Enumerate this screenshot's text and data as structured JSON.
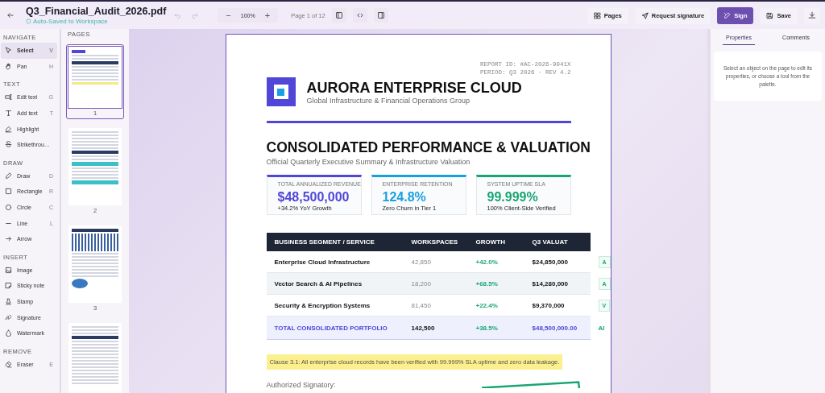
{
  "topbar": {
    "filename": "Q3_Financial_Audit_2026.pdf",
    "autosave": "Auto-Saved to Workspace",
    "undo_disabled": true,
    "redo_disabled": true,
    "zoom": {
      "minus": "−",
      "value": "100%",
      "plus": "+"
    },
    "page_indicator": "Page 1 of 12",
    "actions": [
      {
        "label": "Pages",
        "kind": "secondary"
      },
      {
        "label": "Request signature",
        "kind": "secondary"
      },
      {
        "label": "Sign",
        "kind": "primary"
      },
      {
        "label": "Save",
        "kind": "secondary"
      }
    ]
  },
  "tools": [
    {
      "title": "NAVIGATE",
      "items": [
        {
          "label": "Select",
          "shortcut": "V",
          "selected": true
        },
        {
          "label": "Pan",
          "shortcut": "H",
          "selected": false
        }
      ]
    },
    {
      "title": "TEXT",
      "items": [
        {
          "label": "Edit text",
          "shortcut": "G",
          "selected": false
        },
        {
          "label": "Add text",
          "shortcut": "T",
          "selected": false
        },
        {
          "label": "Highlight",
          "selected": false
        },
        {
          "label": "Strikethrou…",
          "selected": false
        }
      ]
    },
    {
      "title": "DRAW",
      "items": [
        {
          "label": "Draw",
          "shortcut": "D",
          "selected": false
        },
        {
          "label": "Rectangle",
          "shortcut": "R",
          "selected": false
        },
        {
          "label": "Circle",
          "shortcut": "C",
          "selected": false
        },
        {
          "label": "Line",
          "shortcut": "L",
          "selected": false
        },
        {
          "label": "Arrow",
          "selected": false
        }
      ]
    },
    {
      "title": "INSERT",
      "items": [
        {
          "label": "Image",
          "selected": false
        },
        {
          "label": "Sticky note",
          "selected": false
        },
        {
          "label": "Stamp",
          "selected": false
        },
        {
          "label": "Signature",
          "selected": false
        },
        {
          "label": "Watermark",
          "selected": false
        }
      ]
    },
    {
      "title": "REMOVE",
      "items": [
        {
          "label": "Eraser",
          "shortcut": "E",
          "selected": false
        }
      ]
    }
  ],
  "pages": {
    "title": "PAGES",
    "thumbnails": [
      {
        "number": "1",
        "kind": "summary",
        "selected": true
      },
      {
        "number": "2",
        "kind": "invoice",
        "selected": false
      },
      {
        "number": "3",
        "kind": "chart",
        "selected": false
      },
      {
        "kind": "form",
        "selected": false
      }
    ]
  },
  "document": {
    "logo_title": "AURORA ENTERPRISE CLOUD",
    "logo_subtitle": "Global Infrastructure & Financial Operations Group",
    "report_id": "REPORT ID: #AC-2026-9941X",
    "period": "PERIOD: Q3 2026 · REV 4.2",
    "heading": "CONSOLIDATED PERFORMANCE & VALUATION",
    "subheading": "Official Quarterly Executive Summary & Infrastructure Valuation",
    "kpis": [
      {
        "label": "TOTAL ANNUALIZED REVENUE",
        "value": "$48,500,000",
        "note": "+34.2% YoY Growth",
        "color": "#5046d8"
      },
      {
        "label": "ENTERPRISE RETENTION",
        "value": "124.8%",
        "note": "Zero Churn in Tier 1",
        "color": "#1a9fe0"
      },
      {
        "label": "SYSTEM UPTIME SLA",
        "value": "99.999%",
        "note": "100% Client-Side Verified",
        "color": "#17a673"
      }
    ],
    "table": {
      "columns": [
        "BUSINESS SEGMENT / SERVICE",
        "WORKSPACES",
        "GROWTH",
        "Q3 VALUAT"
      ],
      "rows": [
        {
          "kind": "normal",
          "cells": [
            "Enterprise Cloud Infrastructure",
            "42,850",
            "+42.0%",
            "$24,850,000",
            "A"
          ]
        },
        {
          "kind": "normal",
          "cells": [
            "Vector Search & AI Pipelines",
            "18,200",
            "+68.5%",
            "$14,280,000",
            "A"
          ]
        },
        {
          "kind": "normal",
          "cells": [
            "Security & Encryption Systems",
            "81,450",
            "+22.4%",
            "$9,370,000",
            "V"
          ]
        },
        {
          "kind": "total",
          "cells": [
            "TOTAL CONSOLIDATED PORTFOLIO",
            "142,500",
            "+38.5%",
            "$48,500,000.00",
            "AI"
          ]
        }
      ]
    },
    "clause": "Clause 3.1: All enterprise cloud records have been verified with 99.999% SLA uptime and zero data leakage.",
    "signatory": "Authorized Signatory:"
  },
  "properties_panel": {
    "tabs": [
      {
        "label": "Properties",
        "selected": true
      },
      {
        "label": "Comments",
        "selected": false
      }
    ],
    "hint": "Select an object on the page to edit its properties, or choose a tool from the palette."
  }
}
